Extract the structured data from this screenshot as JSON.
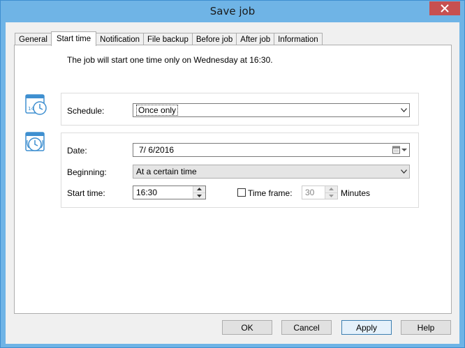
{
  "window": {
    "title": "Save job"
  },
  "tabs": [
    "General",
    "Start time",
    "Notification",
    "File backup",
    "Before job",
    "After job",
    "Information"
  ],
  "active_tab": "Start time",
  "summary": "The job will start one time only on Wednesday at 16:30.",
  "schedule": {
    "label": "Schedule:",
    "value": "Once only"
  },
  "date": {
    "label": "Date:",
    "value": "7/ 6/2016"
  },
  "beginning": {
    "label": "Beginning:",
    "value": "At a certain time"
  },
  "start_time": {
    "label": "Start time:",
    "value": "16:30"
  },
  "time_frame": {
    "label": "Time frame:",
    "checked": false,
    "value": "30",
    "unit": "Minutes"
  },
  "buttons": {
    "ok": "OK",
    "cancel": "Cancel",
    "apply": "Apply",
    "help": "Help"
  },
  "icons": {
    "close": "close-icon",
    "calendar": "calendar-clock-icon",
    "alarm": "alarm-clock-icon",
    "dropdown": "chevron-down-icon",
    "date_picker": "calendar-picker-icon"
  }
}
